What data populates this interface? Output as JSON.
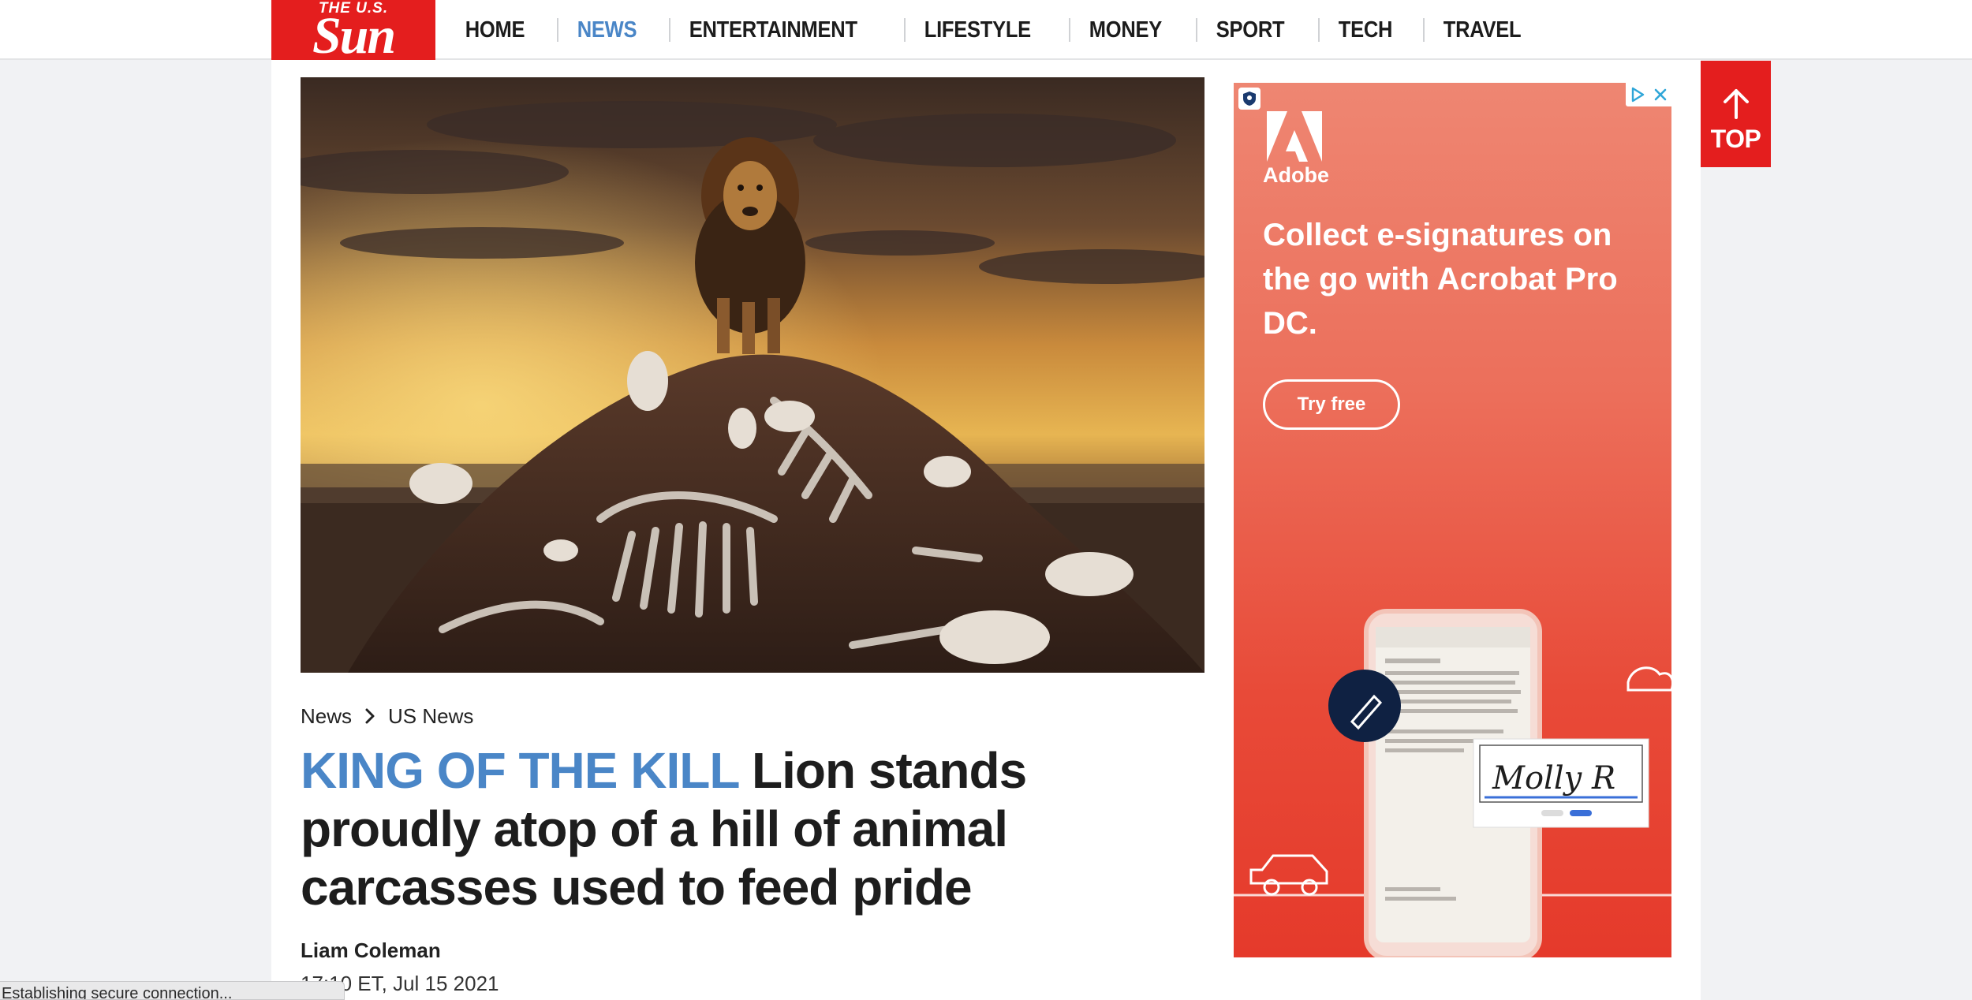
{
  "logo": {
    "top_text": "THE U.S.",
    "main_text": "Sun"
  },
  "nav": {
    "items": [
      {
        "label": "HOME"
      },
      {
        "label": "NEWS",
        "active": true
      },
      {
        "label": "ENTERTAINMENT"
      },
      {
        "label": "LIFESTYLE"
      },
      {
        "label": "MONEY"
      },
      {
        "label": "SPORT"
      },
      {
        "label": "TECH"
      },
      {
        "label": "TRAVEL"
      }
    ],
    "active_color": "#4a86c7"
  },
  "breadcrumb": {
    "items": [
      "News",
      "US News"
    ]
  },
  "article": {
    "kicker": "KING OF THE KILL",
    "headline": "Lion stands proudly atop of a hill of animal carcasses used to feed pride",
    "author": "Liam Coleman",
    "timestamp": "17:10 ET, Jul 15 2021"
  },
  "ad": {
    "brand": "Adobe",
    "headline": "Collect e-signatures on the go with Acrobat Pro DC.",
    "cta": "Try free",
    "signature_text": "Molly R",
    "background_color": "#e84a38"
  },
  "back_to_top": {
    "label": "TOP"
  },
  "status": {
    "text": "Establishing secure connection..."
  },
  "colors": {
    "brand_red": "#e41e1e",
    "accent_blue": "#4a86c7"
  }
}
